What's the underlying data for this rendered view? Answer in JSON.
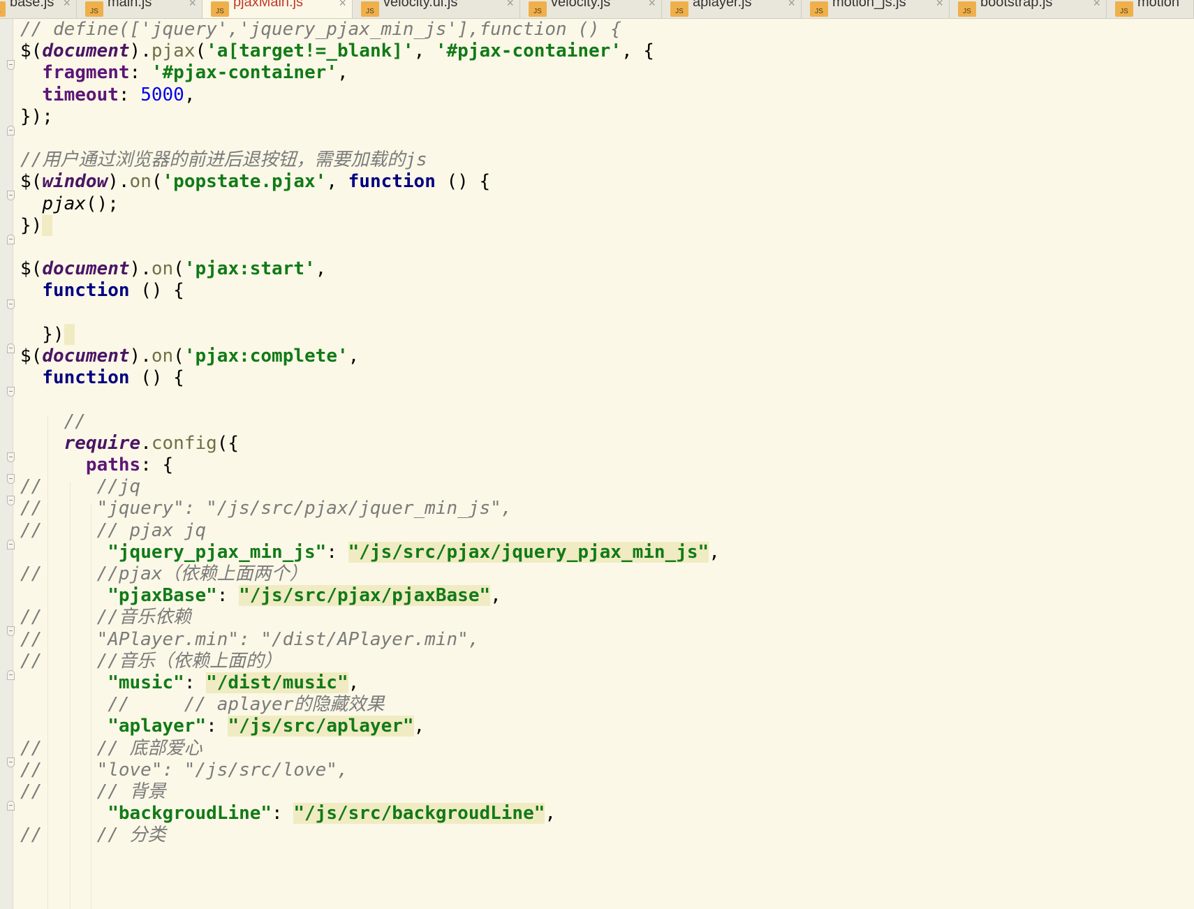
{
  "tabs": [
    {
      "label": "base.js",
      "icon": "js-file-icon",
      "active": false
    },
    {
      "label": "main.js",
      "icon": "js-file-icon",
      "active": false
    },
    {
      "label": "pjaxMain.js",
      "icon": "js-file-icon",
      "active": true
    },
    {
      "label": "velocity.ui.js",
      "icon": "js-file-icon",
      "active": false
    },
    {
      "label": "velocity.js",
      "icon": "js-file-icon",
      "active": false
    },
    {
      "label": "aplayer.js",
      "icon": "js-file-icon",
      "active": false
    },
    {
      "label": "motion_js.js",
      "icon": "js-file-icon",
      "active": false
    },
    {
      "label": "bootstrap.js",
      "icon": "js-file-icon",
      "active": false
    },
    {
      "label": "motion",
      "icon": "js-file-icon",
      "active": false
    }
  ],
  "tab_icon_text": "JS",
  "tab_close_glyph": "×",
  "code_lines": [
    {
      "tokens": [
        [
          "cm",
          "// define(['jquery','jquery_pjax_min_js'],function () {"
        ]
      ]
    },
    {
      "tokens": [
        [
          "pl",
          "$("
        ],
        [
          "ob",
          "document"
        ],
        [
          "pl",
          ")."
        ],
        [
          "fn",
          "pjax"
        ],
        [
          "pl",
          "("
        ],
        [
          "st",
          "'a[target!=_blank]'"
        ],
        [
          "pl",
          ", "
        ],
        [
          "st",
          "'#pjax-container'"
        ],
        [
          "pl",
          ", {"
        ]
      ]
    },
    {
      "tokens": [
        [
          "pl",
          "  "
        ],
        [
          "pr",
          "fragment"
        ],
        [
          "pl",
          ": "
        ],
        [
          "st",
          "'#pjax-container'"
        ],
        [
          "pl",
          ","
        ]
      ]
    },
    {
      "tokens": [
        [
          "pl",
          "  "
        ],
        [
          "pr",
          "timeout"
        ],
        [
          "pl",
          ": "
        ],
        [
          "nu",
          "5000"
        ],
        [
          "pl",
          ","
        ]
      ]
    },
    {
      "tokens": [
        [
          "pl",
          "});"
        ]
      ]
    },
    {
      "tokens": []
    },
    {
      "tokens": [
        [
          "cm",
          "//用户通过浏览器的前进后退按钮，需要加载的js"
        ]
      ]
    },
    {
      "tokens": [
        [
          "pl",
          "$("
        ],
        [
          "ob",
          "window"
        ],
        [
          "pl",
          ")."
        ],
        [
          "fn",
          "on"
        ],
        [
          "pl",
          "("
        ],
        [
          "st",
          "'popstate.pjax'"
        ],
        [
          "pl",
          ", "
        ],
        [
          "kw",
          "function"
        ],
        [
          "pl",
          " () {"
        ]
      ]
    },
    {
      "tokens": [
        [
          "pl",
          "  "
        ],
        [
          "it",
          "pjax"
        ],
        [
          "pl",
          "();"
        ]
      ]
    },
    {
      "tokens": [
        [
          "pl",
          "})"
        ],
        [
          "caret",
          ""
        ]
      ]
    },
    {
      "tokens": []
    },
    {
      "tokens": [
        [
          "pl",
          "$("
        ],
        [
          "ob",
          "document"
        ],
        [
          "pl",
          ")."
        ],
        [
          "fn",
          "on"
        ],
        [
          "pl",
          "("
        ],
        [
          "st",
          "'pjax:start'"
        ],
        [
          "pl",
          ","
        ]
      ]
    },
    {
      "tokens": [
        [
          "pl",
          "  "
        ],
        [
          "kw",
          "function"
        ],
        [
          "pl",
          " () {"
        ]
      ]
    },
    {
      "tokens": []
    },
    {
      "tokens": [
        [
          "pl",
          "  })"
        ],
        [
          "caret",
          ""
        ]
      ]
    },
    {
      "tokens": [
        [
          "pl",
          "$("
        ],
        [
          "ob",
          "document"
        ],
        [
          "pl",
          ")."
        ],
        [
          "fn",
          "on"
        ],
        [
          "pl",
          "("
        ],
        [
          "st",
          "'pjax:complete'"
        ],
        [
          "pl",
          ","
        ]
      ]
    },
    {
      "tokens": [
        [
          "pl",
          "  "
        ],
        [
          "kw",
          "function"
        ],
        [
          "pl",
          " () {"
        ]
      ]
    },
    {
      "tokens": []
    },
    {
      "tokens": [
        [
          "pl",
          "    "
        ],
        [
          "cm",
          "//"
        ]
      ]
    },
    {
      "tokens": [
        [
          "pl",
          "    "
        ],
        [
          "ob",
          "require"
        ],
        [
          "pl",
          "."
        ],
        [
          "fn",
          "config"
        ],
        [
          "pl",
          "({"
        ]
      ]
    },
    {
      "tokens": [
        [
          "pl",
          "      "
        ],
        [
          "pr",
          "paths"
        ],
        [
          "pl",
          ": {"
        ]
      ]
    },
    {
      "tokens": [
        [
          "cm",
          "//     //jq"
        ]
      ]
    },
    {
      "tokens": [
        [
          "cm",
          "//     \"jquery\": \"/js/src/pjax/jquer_min_js\","
        ]
      ]
    },
    {
      "tokens": [
        [
          "cm",
          "//     // pjax jq"
        ]
      ]
    },
    {
      "tokens": [
        [
          "pl",
          "        "
        ],
        [
          "st",
          "\"jquery_pjax_min_js\""
        ],
        [
          "pl",
          ": "
        ],
        [
          "st",
          "\"/js/src/pjax/jquery_pjax_min_js\""
        ],
        [
          "pl",
          ","
        ]
      ]
    },
    {
      "tokens": [
        [
          "cm",
          "//     //pjax（依赖上面两个）"
        ]
      ]
    },
    {
      "tokens": [
        [
          "pl",
          "        "
        ],
        [
          "st",
          "\"pjaxBase\""
        ],
        [
          "pl",
          ": "
        ],
        [
          "st",
          "\"/js/src/pjax/pjaxBase\""
        ],
        [
          "pl",
          ","
        ]
      ]
    },
    {
      "tokens": [
        [
          "cm",
          "//     //音乐依赖"
        ]
      ]
    },
    {
      "tokens": [
        [
          "cm",
          "//     \"APlayer.min\": \"/dist/APlayer.min\","
        ]
      ]
    },
    {
      "tokens": [
        [
          "cm",
          "//     //音乐（依赖上面的）"
        ]
      ]
    },
    {
      "tokens": [
        [
          "pl",
          "        "
        ],
        [
          "st",
          "\"music\""
        ],
        [
          "pl",
          ": "
        ],
        [
          "st",
          "\"/dist/music\""
        ],
        [
          "pl",
          ","
        ]
      ]
    },
    {
      "tokens": [
        [
          "pl",
          "        "
        ],
        [
          "cm",
          "//     // aplayer的隐藏效果"
        ]
      ]
    },
    {
      "tokens": [
        [
          "pl",
          "        "
        ],
        [
          "st",
          "\"aplayer\""
        ],
        [
          "pl",
          ": "
        ],
        [
          "st",
          "\"/js/src/aplayer\""
        ],
        [
          "pl",
          ","
        ]
      ]
    },
    {
      "tokens": [
        [
          "cm",
          "//     // 底部爱心"
        ]
      ]
    },
    {
      "tokens": [
        [
          "cm",
          "//     \"love\": \"/js/src/love\","
        ]
      ]
    },
    {
      "tokens": [
        [
          "cm",
          "//     // 背景"
        ]
      ]
    },
    {
      "tokens": [
        [
          "pl",
          "        "
        ],
        [
          "st",
          "\"backgroudLine\""
        ],
        [
          "pl",
          ": "
        ],
        [
          "st",
          "\"/js/src/backgroudLine\""
        ],
        [
          "pl",
          ","
        ]
      ]
    },
    {
      "tokens": [
        [
          "cm",
          "//     // 分类"
        ]
      ]
    }
  ]
}
